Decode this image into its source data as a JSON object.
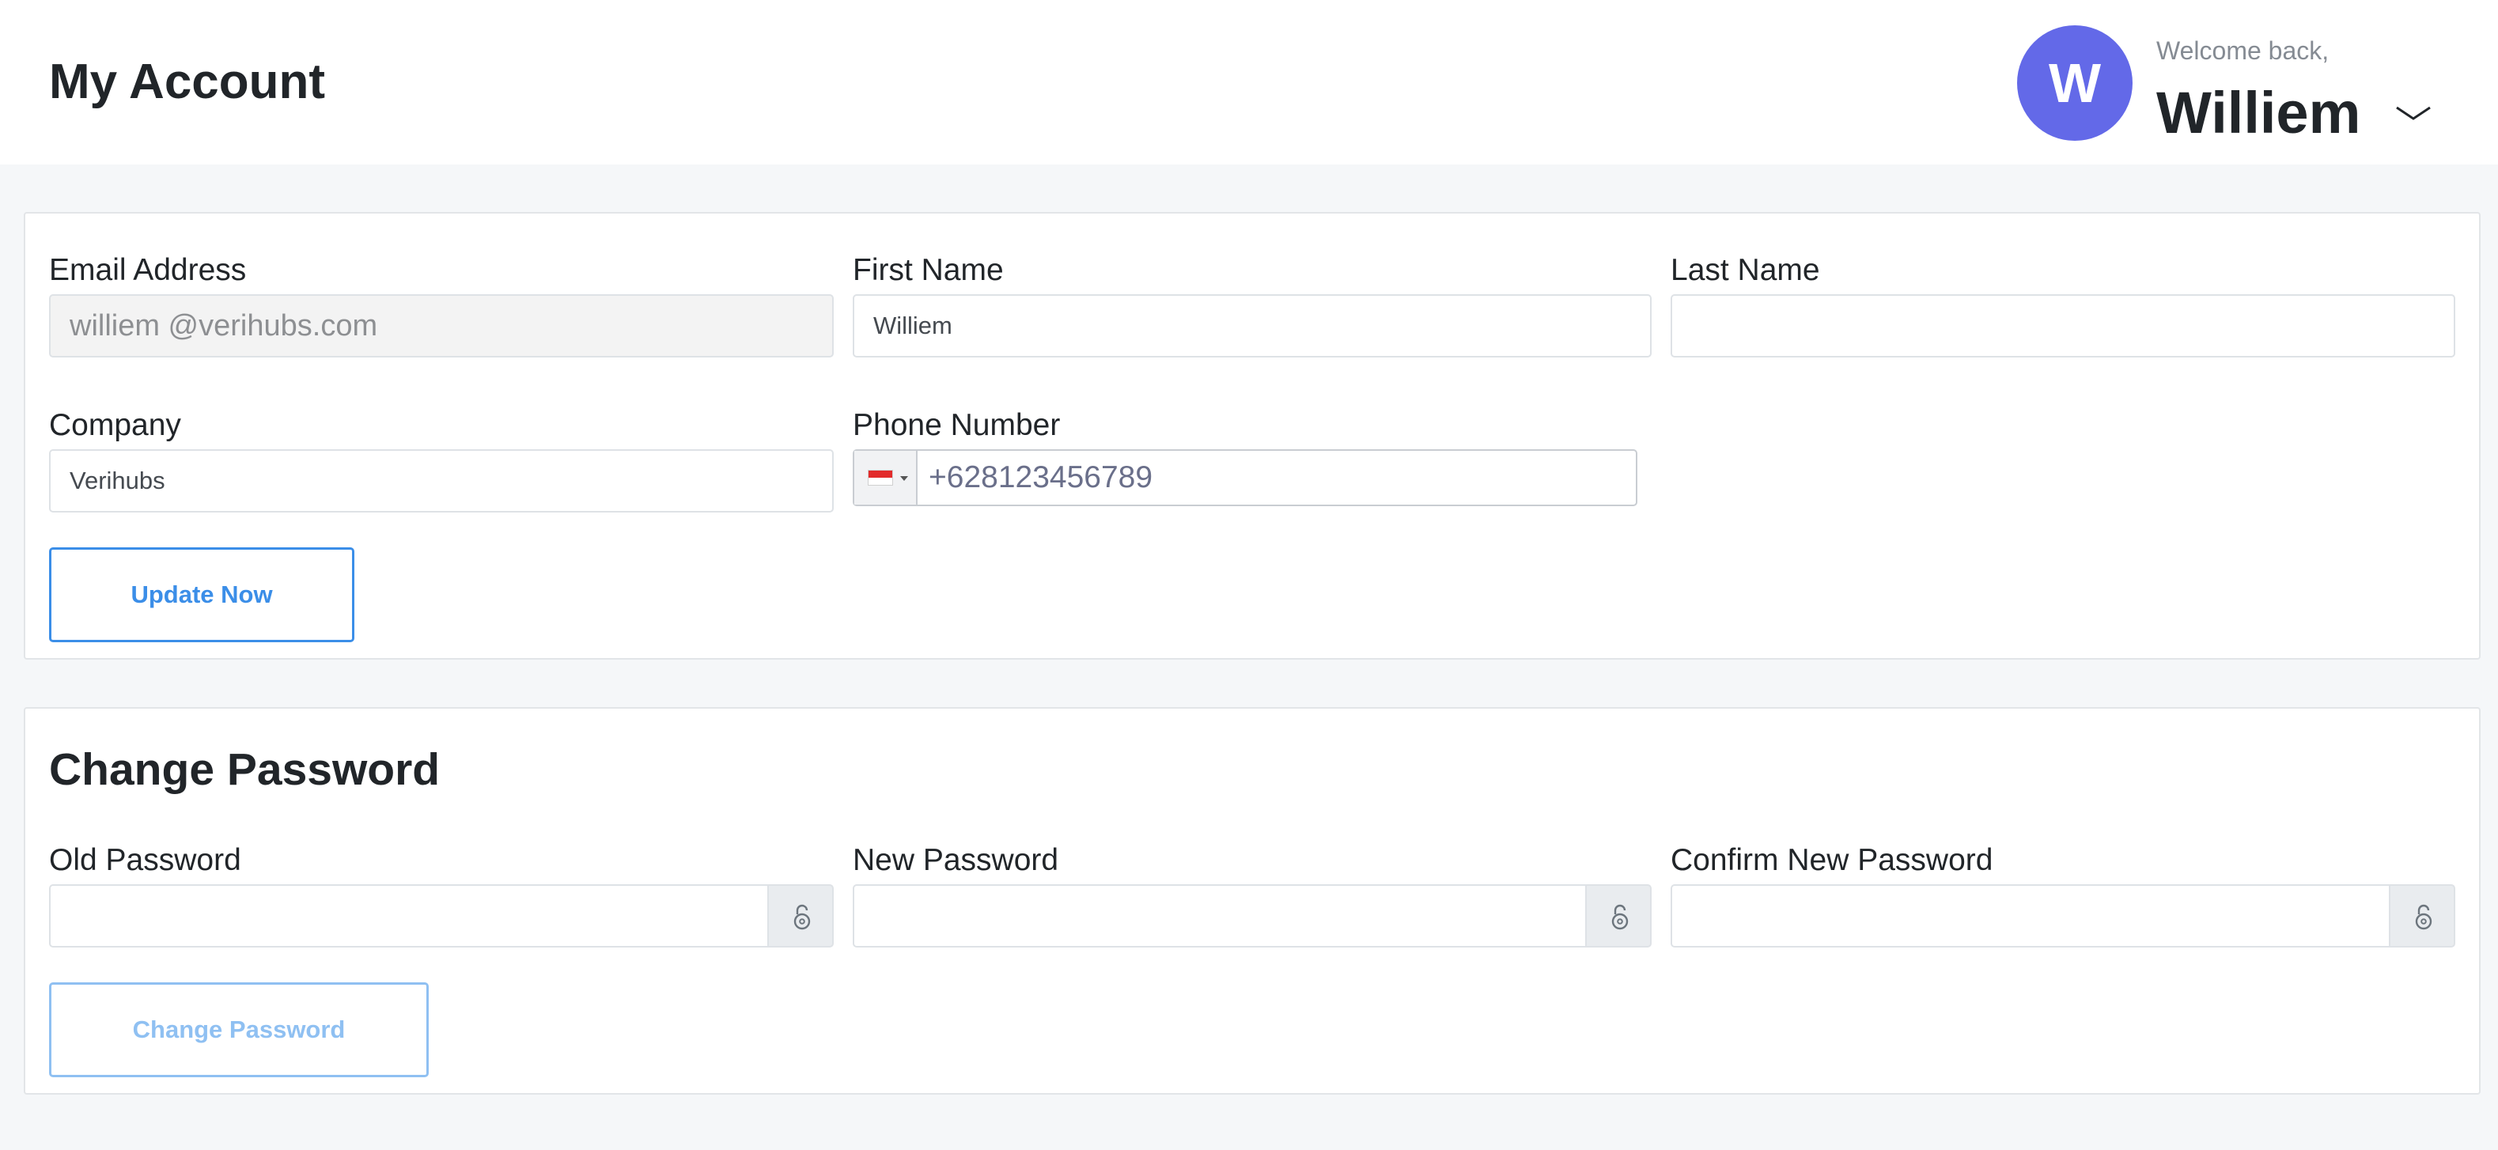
{
  "header": {
    "title": "My Account",
    "welcome_text": "Welcome back,",
    "user_name": "Williem",
    "avatar_initial": "W",
    "avatar_color": "#6369e8"
  },
  "profile": {
    "email": {
      "label": "Email Address",
      "value": "williem @verihubs.com"
    },
    "first_name": {
      "label": "First Name",
      "value": "Williem"
    },
    "last_name": {
      "label": "Last Name",
      "value": ""
    },
    "company": {
      "label": "Company",
      "value": "Verihubs"
    },
    "phone": {
      "label": "Phone Number",
      "value": "+628123456789",
      "country_flag": "indonesia-flag-icon"
    },
    "update_button": "Update Now"
  },
  "password": {
    "section_title": "Change Password",
    "old_label": "Old Password",
    "new_label": "New Password",
    "confirm_label": "Confirm New Password",
    "toggle_icon": "lock-icon",
    "change_button": "Change Password"
  },
  "colors": {
    "accent": "#3b8ee8",
    "accent_muted": "#8fc0f2",
    "background": "#f5f7f9"
  }
}
